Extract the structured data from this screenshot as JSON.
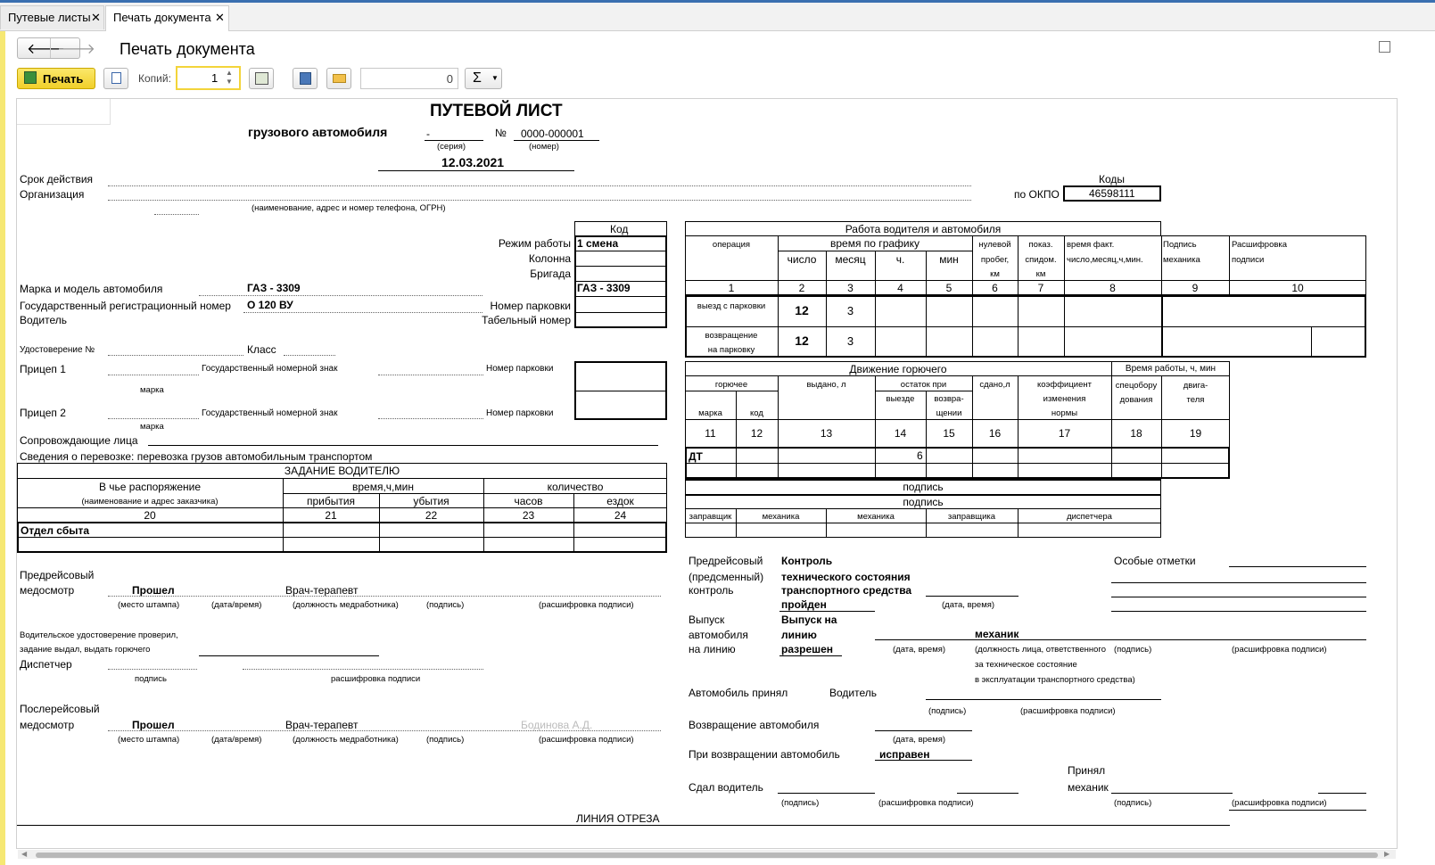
{
  "tabs": [
    {
      "label": "Путевые листы"
    },
    {
      "label": "Печать документа"
    }
  ],
  "page": {
    "title": "Печать документа"
  },
  "toolbar": {
    "print_label": "Печать",
    "copies_label": "Копий:",
    "copies_value": "1",
    "counter_value": "0",
    "sum_label": "Σ"
  },
  "doc": {
    "title": "ПУТЕВОЙ ЛИСТ",
    "subtitle": "грузового автомобиля",
    "series_value": "-",
    "series_caption": "(серия)",
    "no_label": "№",
    "number": "0000-000001",
    "number_caption": "(номер)",
    "date": "12.03.2021",
    "validity_label": "Срок действия",
    "org_label": "Организация",
    "org_caption": "(наименование, адрес и номер телефона, ОГРН)",
    "codes_title": "Коды",
    "okpo_label": "по ОКПО",
    "okpo_value": "46598111",
    "code_title": "Код",
    "mode_label": "Режим работы",
    "mode_value": "1 смена",
    "column_label": "Колонна",
    "brigade_label": "Бригада",
    "make_label": "Марка и модель автомобиля",
    "make_value": "ГАЗ - 3309",
    "make_code": "ГАЗ - 3309",
    "regnum_label": "Государственный регистрационный номер",
    "regnum_value": "О 120 ВУ",
    "parking_label": "Номер парковки",
    "driver_label": "Водитель",
    "tabnum_label": "Табельный номер",
    "license_label": "Удостоверение №",
    "class_label": "Класс",
    "trailer1_label": "Прицеп 1",
    "trailer2_label": "Прицеп 2",
    "state_plate_label": "Государственный номерной знак",
    "parking_small": "Номер парковки",
    "mark_caption": "марка",
    "escort_label": "Сопровождающие лица",
    "transport_info": "Сведения о перевозке: перевозка грузов автомобильным транспортом"
  },
  "work": {
    "title": "Работа водителя и автомобиля",
    "op": "операция",
    "sched": "время по графику",
    "day": "число",
    "month": "месяц",
    "hour": "ч.",
    "min": "мин",
    "zero_l1": "нулевой",
    "zero_l2": "пробег,",
    "zero_l3": "км",
    "odo_l1": "показ.",
    "odo_l2": "спидом.",
    "odo_l3": "км",
    "fact_l1": "время факт.",
    "fact_l2": "число,месяц,ч,мин.",
    "mech_l1": "Подпись",
    "mech_l2": "механика",
    "dec_l1": "Расшифровка",
    "dec_l2": "подписи",
    "nums": [
      "1",
      "2",
      "3",
      "4",
      "5",
      "6",
      "7",
      "8",
      "9",
      "10"
    ],
    "out_label": "выезд с парковки",
    "out_day": "12",
    "out_month": "3",
    "ret_l1": "возвращение",
    "ret_l2": "на парковку",
    "ret_day": "12",
    "ret_month": "3"
  },
  "fuel": {
    "title": "Движение горючего",
    "hours_title": "Время работы, ч, мин",
    "fuel": "горючее",
    "issued": "выдано, л",
    "rest": "остаток при",
    "rest_out": "выезде",
    "rest_ret_l1": "возвра-",
    "rest_ret_l2": "щении",
    "handed": "сдано,л",
    "coef_l1": "коэффициент",
    "coef_l2": "изменения",
    "coef_l3": "нормы",
    "spec_l1": "спецобору",
    "spec_l2": "дования",
    "eng_l1": "двига-",
    "eng_l2": "теля",
    "mark": "марка",
    "code": "код",
    "nums": [
      "11",
      "12",
      "13",
      "14",
      "15",
      "16",
      "17",
      "18",
      "19"
    ],
    "row_type": "ДТ",
    "row_rest": "6",
    "sign": "подпись",
    "sig_cols": [
      "заправщик",
      "механика",
      "механика",
      "заправщика",
      "диспетчера"
    ]
  },
  "task": {
    "title": "ЗАДАНИЕ ВОДИТЕЛЮ",
    "whom": "В чье распоряжение",
    "whom_caption": "(наименование и адрес заказчика)",
    "time": "время,ч,мин",
    "arrival": "прибытия",
    "departure": "убытия",
    "qty": "количество",
    "hours": "часов",
    "rides": "ездок",
    "nums": [
      "20",
      "21",
      "22",
      "23",
      "24"
    ],
    "row1": "Отдел сбыта"
  },
  "med": {
    "pre_l1": "Предрейсовый",
    "pre_l2": "медосмотр",
    "passed": "Прошел",
    "doctor": "Врач-терапевт",
    "cap_stamp": "(место штампа)",
    "cap_dt": "(дата/время)",
    "cap_pos": "(должность медработника)",
    "cap_sign": "(подпись)",
    "cap_dec": "(расшифровка подписи)",
    "check_l1": "Водительское удостоверение проверил,",
    "check_l2": "задание выдал, выдать горючего",
    "dispatcher": "Диспетчер",
    "sign_cap": "подпись",
    "dec_cap": "расшифровка подписи",
    "post_l1": "Послерейсовый",
    "post_l2": "медосмотр",
    "post_passed": "Прошел",
    "post_doctor": "Врач-терапевт",
    "post_name": "Бодинова А.Д."
  },
  "ctrl": {
    "pre_l1": "Предрейсовый",
    "pre_l2": "(предсменный)",
    "pre_l3": "контроль",
    "ctrl_l1": "Контроль",
    "ctrl_l2": "технического состояния",
    "ctrl_l3": "транспортного средства",
    "ctrl_l4": "пройден",
    "dt_cap": "(дата, время)",
    "special": "Особые отметки",
    "rel_l1": "Выпуск",
    "rel_l2": "автомобиля",
    "rel_l3": "на линию",
    "relv_l1": "Выпуск на",
    "relv_l2": "линию",
    "relv_l3": "разрешен",
    "mechanic": "механик",
    "resp_l1": "(должность лица, ответственного",
    "resp_l2": "за техническое состояние",
    "resp_l3": "в эксплуатации транспортного средства)",
    "sign_cap": "(подпись)",
    "dec_cap": "(расшифровка подписи)",
    "accepted": "Автомобиль принял",
    "driver": "Водитель",
    "return": "Возвращение автомобиля",
    "on_return": "При возвращении автомобиль",
    "ok": "исправен",
    "handed": "Сдал водитель",
    "accepted_l1": "Принял",
    "accepted_l2": "механик",
    "cut": "ЛИНИЯ ОТРЕЗА"
  }
}
